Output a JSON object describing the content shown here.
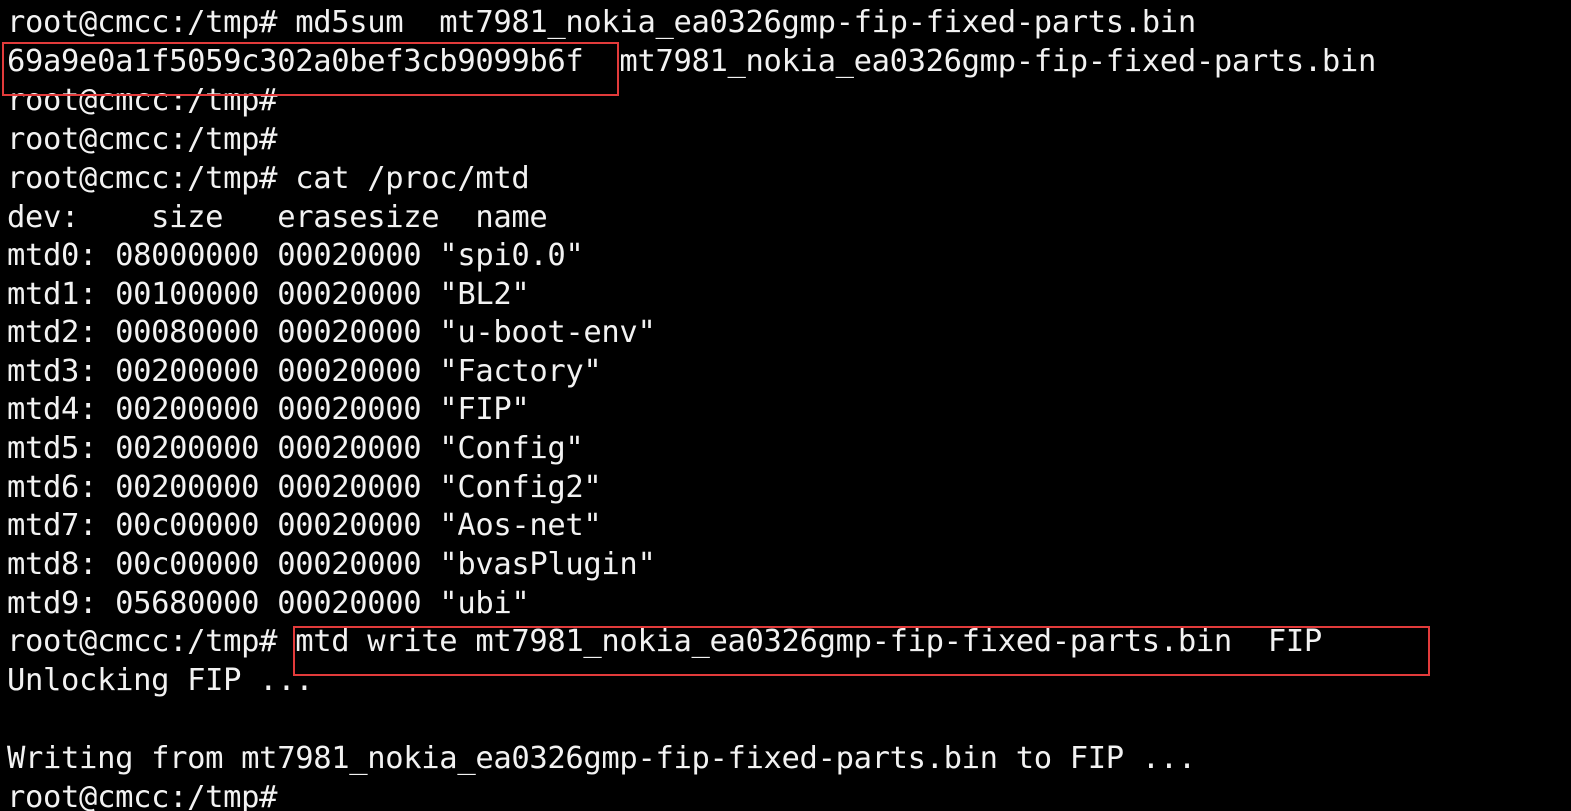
{
  "terminal": {
    "lines": [
      "root@cmcc:/tmp# md5sum  mt7981_nokia_ea0326gmp-fip-fixed-parts.bin",
      "69a9e0a1f5059c302a0bef3cb9099b6f  mt7981_nokia_ea0326gmp-fip-fixed-parts.bin",
      "root@cmcc:/tmp#",
      "root@cmcc:/tmp#",
      "root@cmcc:/tmp# cat /proc/mtd",
      "dev:    size   erasesize  name",
      "mtd0: 08000000 00020000 \"spi0.0\"",
      "mtd1: 00100000 00020000 \"BL2\"",
      "mtd2: 00080000 00020000 \"u-boot-env\"",
      "mtd3: 00200000 00020000 \"Factory\"",
      "mtd4: 00200000 00020000 \"FIP\"",
      "mtd5: 00200000 00020000 \"Config\"",
      "mtd6: 00200000 00020000 \"Config2\"",
      "mtd7: 00c00000 00020000 \"Aos-net\"",
      "mtd8: 00c00000 00020000 \"bvasPlugin\"",
      "mtd9: 05680000 00020000 \"ubi\"",
      "root@cmcc:/tmp# mtd write mt7981_nokia_ea0326gmp-fip-fixed-parts.bin  FIP",
      "Unlocking FIP ...",
      "",
      "Writing from mt7981_nokia_ea0326gmp-fip-fixed-parts.bin to FIP ...",
      "root@cmcc:/tmp#"
    ]
  },
  "colors": {
    "background": "#000000",
    "text": "#f2f2f2",
    "highlight_box": "#e23b3b"
  }
}
